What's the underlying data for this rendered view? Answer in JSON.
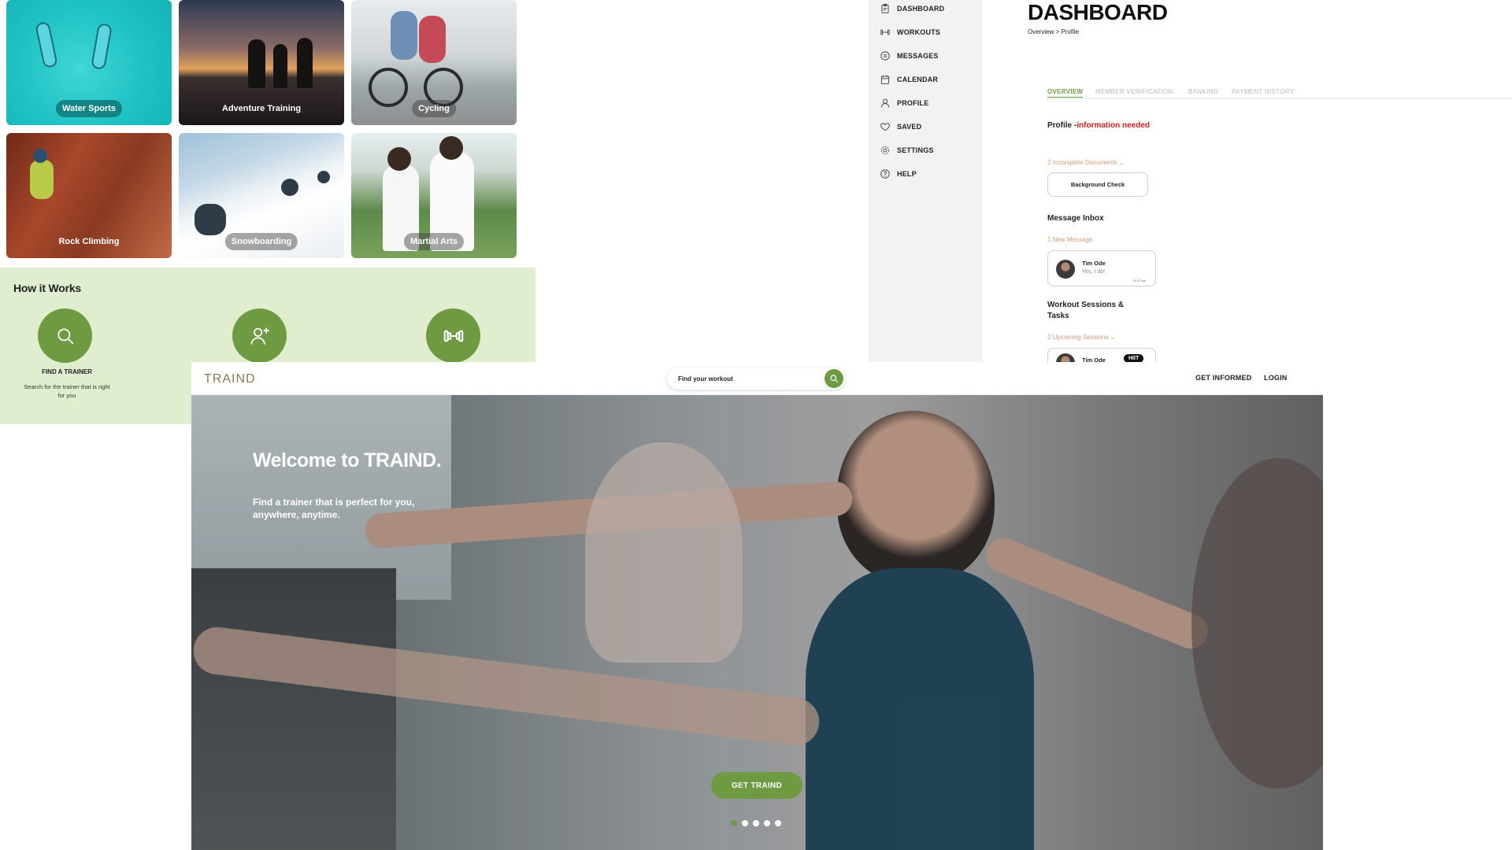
{
  "categories": [
    {
      "label": "Water Sports"
    },
    {
      "label": "Adventure Training"
    },
    {
      "label": "Cycling"
    },
    {
      "label": "Rock Climbing"
    },
    {
      "label": "Snowboarding"
    },
    {
      "label": "Martial Arts"
    }
  ],
  "how_it_works": {
    "title": "How it Works",
    "steps": [
      {
        "title": "FIND A TRAINER",
        "text": "Search for the trainer that is right for you",
        "icon": "search-icon"
      },
      {
        "title": "",
        "text": "",
        "icon": "user-add-icon"
      },
      {
        "title": "",
        "text": "",
        "icon": "dumbbell-icon"
      }
    ],
    "accent": "#6e9b42",
    "background": "#e0eecf"
  },
  "dashboard": {
    "title": "DASHBOARD",
    "breadcrumb": "Overview > Profile",
    "nav": [
      {
        "label": "DASHBOARD",
        "icon": "clipboard-icon"
      },
      {
        "label": "WORKOUTS",
        "icon": "dumbbell-icon"
      },
      {
        "label": "MESSAGES",
        "icon": "message-icon"
      },
      {
        "label": "CALENDAR",
        "icon": "calendar-icon"
      },
      {
        "label": "PROFILE",
        "icon": "user-icon"
      },
      {
        "label": "SAVED",
        "icon": "heart-icon"
      },
      {
        "label": "SETTINGS",
        "icon": "gear-icon"
      },
      {
        "label": "HELP",
        "icon": "help-icon"
      }
    ],
    "tabs": [
      "OVERVIEW",
      "MEMBER VERIFICATION",
      "BANKING",
      "PAYMENT HISTORY"
    ],
    "active_tab": "OVERVIEW",
    "profile_label": "Profile -",
    "profile_status": "information needed",
    "incomplete_docs": "2 Incomplete Documents",
    "doc_button": "Background Check",
    "inbox_title": "Message Inbox",
    "new_messages": "1 New Message",
    "message": {
      "name": "Tim Ode",
      "text": "Yes, I do!",
      "time": "11:27 am"
    },
    "sessions_title": "Workout Sessions & Tasks",
    "upcoming": "2 Upcoming Sessions",
    "session": {
      "name": "Tim Ode",
      "tag": "HIIT"
    }
  },
  "landing": {
    "logo": "TRAIND",
    "search_placeholder": "Find your workout",
    "links": [
      "GET INFORMED",
      "LOGIN"
    ],
    "hero_title": "Welcome to TRAIND.",
    "hero_sub": "Find a trainer that is perfect for you, anywhere, anytime.",
    "cta": "GET TRAIND",
    "slides": 5,
    "active_slide": 1,
    "accent": "#6e9b42"
  }
}
